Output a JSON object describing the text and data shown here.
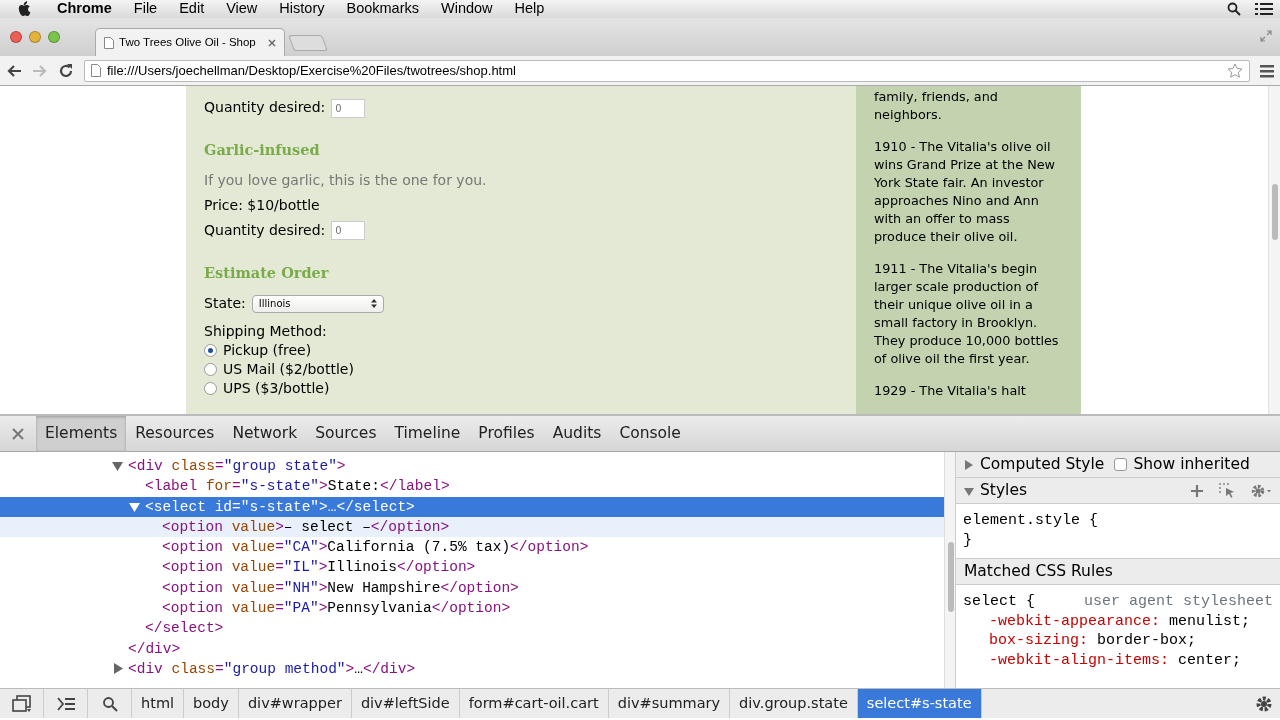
{
  "menubar": {
    "app": "Chrome",
    "items": [
      "File",
      "Edit",
      "View",
      "History",
      "Bookmarks",
      "Window",
      "Help"
    ]
  },
  "browser": {
    "tab_title": "Two Trees Olive Oil - Shop",
    "url": "file:///Users/joechellman/Desktop/Exercise%20Files/twotrees/shop.html"
  },
  "page": {
    "first_quantity": {
      "label": "Quantity desired:",
      "placeholder": "0"
    },
    "product": {
      "title": "Garlic-infused",
      "description": "If you love garlic, this is the one for you.",
      "price": "Price: $10/bottle",
      "quantity": {
        "label": "Quantity desired:",
        "placeholder": "0"
      }
    },
    "estimate": {
      "title": "Estimate Order",
      "state_label": "State:",
      "state_value": "Illinois",
      "shipping_label": "Shipping Method:",
      "shipping_options": [
        {
          "label": "Pickup (free)",
          "selected": true
        },
        {
          "label": "US Mail ($2/bottle)",
          "selected": false
        },
        {
          "label": "UPS ($3/bottle)",
          "selected": false
        }
      ]
    },
    "sidebar": {
      "paragraphs": [
        "family, friends, and neighbors.",
        "1910 - The Vitalia's olive oil wins Grand Prize at the New York State fair. An investor approaches Nino and Ann with an offer to mass produce their olive oil.",
        "1911 - The Vitalia's begin larger scale production of their unique olive oil in a small factory in Brooklyn. They produce 10,000 bottles of olive oil the first year.",
        "1929 - The Vitalia's halt"
      ]
    }
  },
  "devtools": {
    "tabs": [
      {
        "label": "Elements",
        "selected": true
      },
      {
        "label": "Resources",
        "selected": false
      },
      {
        "label": "Network",
        "selected": false
      },
      {
        "label": "Sources",
        "selected": false
      },
      {
        "label": "Timeline",
        "selected": false
      },
      {
        "label": "Profiles",
        "selected": false
      },
      {
        "label": "Audits",
        "selected": false
      },
      {
        "label": "Console",
        "selected": false
      }
    ],
    "dom": [
      {
        "line": "<div class=\"group state\">",
        "expanded": true,
        "selected": false,
        "hovered": false,
        "closing": "</div>",
        "children": [
          {
            "line": "<label for=\"s-state\">State:</label>",
            "selected": false,
            "hovered": false
          },
          {
            "line": "<select id=\"s-state\">…</select>",
            "expanded": true,
            "selected": true,
            "hovered": false,
            "closing": "</select>",
            "children": [
              {
                "line": "<option value>– select –</option>",
                "selected": false,
                "hovered": true
              },
              {
                "line": "<option value=\"CA\">California (7.5% tax)</option>",
                "selected": false,
                "hovered": false
              },
              {
                "line": "<option value=\"IL\">Illinois</option>",
                "selected": false,
                "hovered": false
              },
              {
                "line": "<option value=\"NH\">New Hampshire</option>",
                "selected": false,
                "hovered": false
              },
              {
                "line": "<option value=\"PA\">Pennsylvania</option>",
                "selected": false,
                "hovered": false
              }
            ]
          }
        ]
      },
      {
        "line": "<div class=\"group method\">…</div>",
        "expanded": false,
        "selected": false,
        "hovered": false
      }
    ],
    "styles": {
      "computed": {
        "label": "Computed Style",
        "expanded": false,
        "show_inherited": {
          "label": "Show inherited",
          "checked": false
        }
      },
      "styles_title": "Styles",
      "styles_expanded": true,
      "element_style": [
        "element.style {",
        "}"
      ],
      "matched_title": "Matched CSS Rules",
      "rule": {
        "selector": "select {",
        "origin": "user agent stylesheet",
        "props": [
          {
            "name": "-webkit-appearance:",
            "value": "menulist;"
          },
          {
            "name": "box-sizing:",
            "value": "border-box;"
          },
          {
            "name": "-webkit-align-items:",
            "value": "center;"
          }
        ]
      }
    },
    "breadcrumbs": [
      {
        "label": "html",
        "selected": false
      },
      {
        "label": "body",
        "selected": false
      },
      {
        "label": "div#wrapper",
        "selected": false
      },
      {
        "label": "div#leftSide",
        "selected": false
      },
      {
        "label": "form#cart-oil.cart",
        "selected": false
      },
      {
        "label": "div#summary",
        "selected": false
      },
      {
        "label": "div.group.state",
        "selected": false
      },
      {
        "label": "select#s-state",
        "selected": true
      }
    ]
  }
}
